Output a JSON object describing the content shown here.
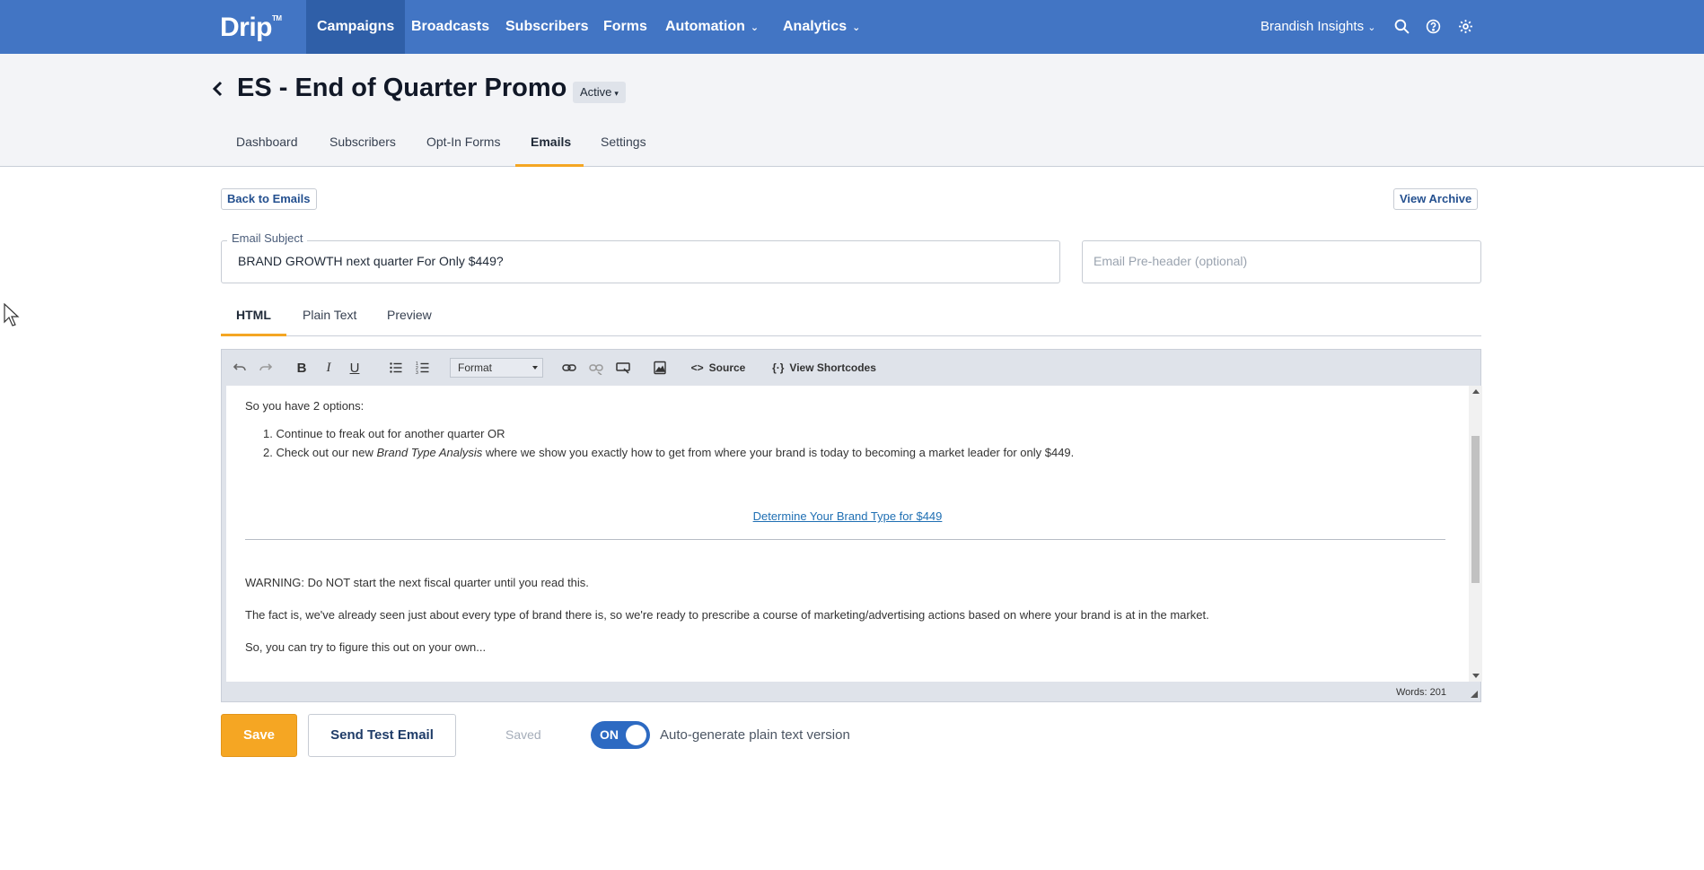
{
  "topnav": {
    "logo": "Drip",
    "logo_tm": "TM",
    "items": [
      {
        "label": "Campaigns",
        "active": true
      },
      {
        "label": "Broadcasts"
      },
      {
        "label": "Subscribers"
      },
      {
        "label": "Forms"
      },
      {
        "label": "Automation",
        "dropdown": true
      },
      {
        "label": "Analytics",
        "dropdown": true
      }
    ],
    "account": "Brandish Insights",
    "icons": [
      "search-icon",
      "help-icon",
      "gear-icon"
    ],
    "color": "#4275c4"
  },
  "header": {
    "title": "ES - End of Quarter Promo",
    "status": "Active",
    "tabs": [
      {
        "label": "Dashboard"
      },
      {
        "label": "Subscribers"
      },
      {
        "label": "Opt-In Forms"
      },
      {
        "label": "Emails",
        "active": true
      },
      {
        "label": "Settings"
      }
    ]
  },
  "actions": {
    "back": "Back to Emails",
    "archive": "View Archive"
  },
  "email": {
    "subject_label": "Email Subject",
    "subject_value": "BRAND GROWTH next quarter For Only $449?",
    "preheader_placeholder": "Email Pre-header (optional)"
  },
  "editor_tabs": [
    {
      "label": "HTML",
      "active": true
    },
    {
      "label": "Plain Text"
    },
    {
      "label": "Preview"
    }
  ],
  "toolbar": {
    "format_label": "Format",
    "source_label": "Source",
    "shortcodes_label": "View Shortcodes"
  },
  "content": {
    "intro": "So you have 2 options:",
    "list": [
      {
        "num": "1.",
        "text": "Continue to freak out for another quarter OR"
      },
      {
        "num": "2.",
        "before": "Check out our new ",
        "italic": "Brand Type Analysis",
        "after": " where we show you exactly how to get from where your brand is today to becoming a market leader for only $449."
      }
    ],
    "link": "Determine Your Brand Type for $449",
    "warning": "WARNING: Do NOT start the next fiscal quarter until you read this.",
    "fact": "The fact is, we've already seen just about every type of brand there is, so we're ready to prescribe a course of marketing/advertising actions based on where your brand is at in the market.",
    "so": "So, you can try to figure this out on your own..."
  },
  "status": {
    "words": "Words: 201"
  },
  "bottom": {
    "save": "Save",
    "send_test": "Send Test Email",
    "saved": "Saved",
    "toggle_state": "ON",
    "toggle_label": "Auto-generate plain text version",
    "accent": "#f5a623"
  }
}
